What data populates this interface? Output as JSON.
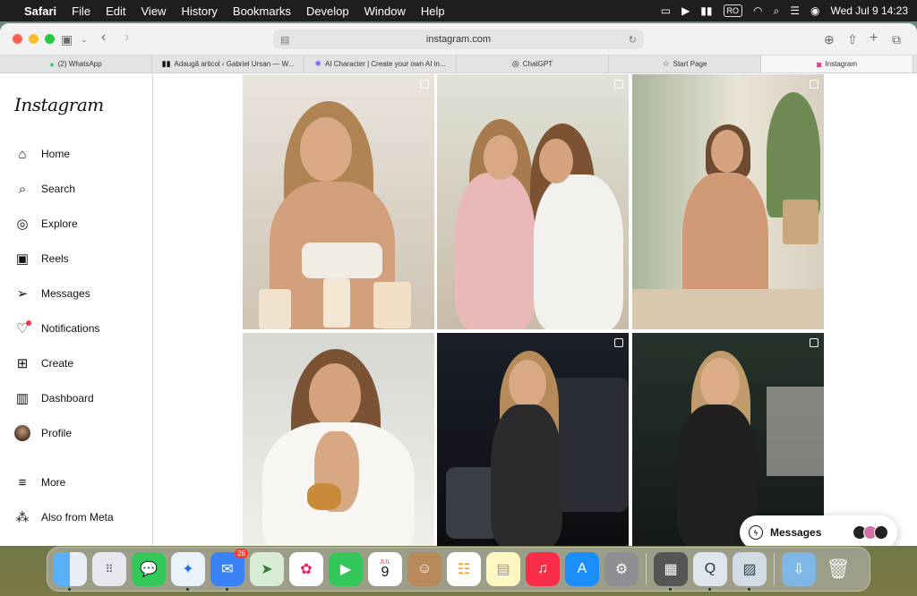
{
  "menubar": {
    "app": "Safari",
    "items": [
      "File",
      "Edit",
      "View",
      "History",
      "Bookmarks",
      "Develop",
      "Window",
      "Help"
    ],
    "input_source": "RO",
    "clock": "Wed Jul 9  14:23"
  },
  "browser": {
    "url": "instagram.com",
    "tabs": [
      {
        "label": "(2) WhatsApp",
        "icon": "whatsapp-icon"
      },
      {
        "label": "Adaugă articol ‹ Gabriel Ursan — W...",
        "icon": "wordpress-icon"
      },
      {
        "label": "AI Character | Create your own AI in...",
        "icon": "ai-icon"
      },
      {
        "label": "ChatGPT",
        "icon": "chatgpt-icon"
      },
      {
        "label": "Start Page",
        "icon": "star-icon"
      },
      {
        "label": "Instagram",
        "icon": "instagram-icon"
      }
    ]
  },
  "instagram": {
    "logo": "Instagram",
    "nav": [
      {
        "label": "Home",
        "icon": "home-icon"
      },
      {
        "label": "Search",
        "icon": "search-icon"
      },
      {
        "label": "Explore",
        "icon": "compass-icon"
      },
      {
        "label": "Reels",
        "icon": "reels-icon"
      },
      {
        "label": "Messages",
        "icon": "send-icon"
      },
      {
        "label": "Notifications",
        "icon": "heart-icon"
      },
      {
        "label": "Create",
        "icon": "plus-square-icon"
      },
      {
        "label": "Dashboard",
        "icon": "chart-icon"
      },
      {
        "label": "Profile",
        "icon": "avatar"
      }
    ],
    "more": [
      {
        "label": "More",
        "icon": "menu-icon"
      },
      {
        "label": "Also from Meta",
        "icon": "meta-grid-icon"
      }
    ],
    "messages_pill": "Messages"
  },
  "dock": {
    "mail_badge": "26",
    "calendar_month": "JUL",
    "calendar_day": "9"
  }
}
